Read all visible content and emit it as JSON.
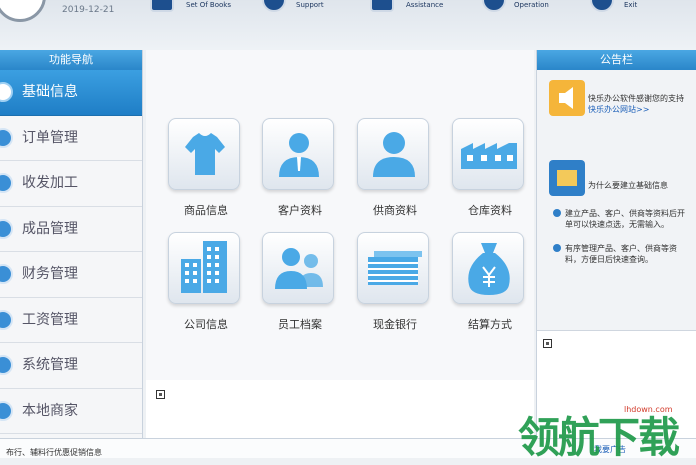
{
  "header": {
    "date": "2019-12-21",
    "toolbar": [
      {
        "label": "Set Of Books",
        "icon": "books-icon"
      },
      {
        "label": "Support",
        "icon": "support-icon"
      },
      {
        "label": "Assistance",
        "icon": "assistance-icon"
      },
      {
        "label": "Operation",
        "icon": "operation-icon"
      },
      {
        "label": "Exit",
        "icon": "exit-icon"
      }
    ]
  },
  "nav": {
    "title": "功能导航",
    "items": [
      {
        "label": "基础信息",
        "icon": "info-icon"
      },
      {
        "label": "订单管理",
        "icon": "order-icon"
      },
      {
        "label": "收发加工",
        "icon": "process-icon"
      },
      {
        "label": "成品管理",
        "icon": "product-icon"
      },
      {
        "label": "财务管理",
        "icon": "finance-icon"
      },
      {
        "label": "工资管理",
        "icon": "salary-icon"
      },
      {
        "label": "系统管理",
        "icon": "system-icon"
      },
      {
        "label": "本地商家",
        "icon": "merchant-icon"
      }
    ]
  },
  "tiles": [
    {
      "label": "商品信息",
      "icon": "shirt-icon"
    },
    {
      "label": "客户资料",
      "icon": "customer-icon"
    },
    {
      "label": "供商资料",
      "icon": "supplier-icon"
    },
    {
      "label": "仓库资料",
      "icon": "warehouse-icon"
    },
    {
      "label": "公司信息",
      "icon": "building-icon"
    },
    {
      "label": "员工档案",
      "icon": "employees-icon"
    },
    {
      "label": "现金银行",
      "icon": "cash-icon"
    },
    {
      "label": "结算方式",
      "icon": "money-bag-icon"
    }
  ],
  "bulletin": {
    "title": "公告栏",
    "notice_line1": "快乐办公软件感谢您的支持",
    "notice_link": "快乐办公网站>>",
    "question": "为什么要建立基础信息",
    "tip1": "建立产品、客户、供商等资料后开单可以快速点选，无需输入。",
    "tip2": "有序管理产品、客户、供商等资料，方便日后快速查询。"
  },
  "status": {
    "text": "布行、辅料行优惠促销信息",
    "button": "我要广告"
  },
  "watermark": {
    "text": "领航下载",
    "url": "lhdown.com"
  },
  "colors": {
    "accent": "#2a86c9",
    "tile_icon": "#4aa9e6",
    "watermark": "#1f9a4a"
  }
}
